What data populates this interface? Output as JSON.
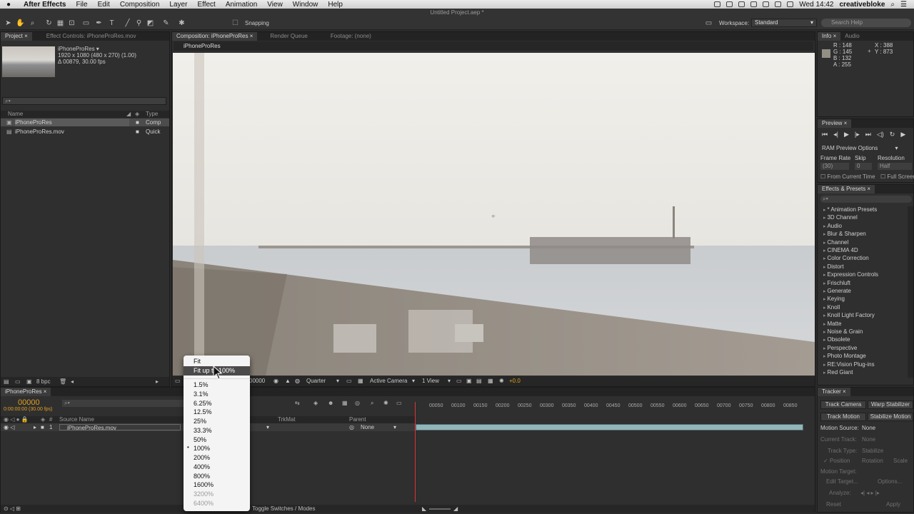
{
  "menubar": {
    "app_name": "After Effects",
    "menus": [
      "File",
      "Edit",
      "Composition",
      "Layer",
      "Effect",
      "Animation",
      "View",
      "Window",
      "Help"
    ],
    "clock": "Wed 14:42",
    "user": "creativebloke"
  },
  "toolbar": {
    "document_title": "Untitled Project.aep *",
    "snapping": "Snapping",
    "workspace_label": "Workspace:",
    "workspace_value": "Standard",
    "search_placeholder": "Search Help"
  },
  "project": {
    "tabs": [
      "Project ×",
      "Effect Controls: iPhoneProRes.mov"
    ],
    "item_name": "iPhoneProRes ▾",
    "item_res": "1920 x 1080  (480 x 270) (1.00)",
    "item_dur": "Δ 00879, 30.00 fps",
    "search_placeholder": "⌕▾",
    "col_name": "Name",
    "col_type": "Type",
    "rows": [
      {
        "name": "iPhoneProRes",
        "type": "Comp"
      },
      {
        "name": "iPhoneProRes.mov",
        "type": "Quick"
      }
    ],
    "bpc": "8 bpc"
  },
  "composition": {
    "tabs": [
      "Composition: iPhoneProRes ×",
      "Render Queue",
      "Footage: (none)"
    ],
    "subtab": "iPhoneProRes",
    "footer": {
      "timecode": "00000",
      "resolution": "Quarter",
      "camera": "Active Camera",
      "view": "1 View",
      "exposure": "+0.0"
    }
  },
  "info": {
    "tabs": [
      "Info ×",
      "Audio"
    ],
    "r": "R : 148",
    "g": "G : 145",
    "b": "B : 132",
    "a": "A : 255",
    "x": "X : 388",
    "y": "Y : 873"
  },
  "preview": {
    "tab": "Preview ×",
    "ram_options": "RAM Preview Options",
    "frame_rate_label": "Frame Rate",
    "skip_label": "Skip",
    "resolution_label": "Resolution",
    "frame_rate_value": "(30)",
    "skip_value": "0",
    "resolution_value": "Half",
    "from_current": "From Current Time",
    "full_screen": "Full Screen"
  },
  "effects": {
    "tab": "Effects & Presets ×",
    "search_placeholder": "⌕▾",
    "items": [
      "* Animation Presets",
      "3D Channel",
      "Audio",
      "Blur & Sharpen",
      "Channel",
      "CINEMA 4D",
      "Color Correction",
      "Distort",
      "Expression Controls",
      "Frischluft",
      "Generate",
      "Keying",
      "Knoll",
      "Knoll Light Factory",
      "Matte",
      "Noise & Grain",
      "Obsolete",
      "Perspective",
      "Photo Montage",
      "RE:Vision Plug-ins",
      "Red Giant"
    ]
  },
  "tracker": {
    "tab": "Tracker ×",
    "track_camera": "Track Camera",
    "warp_stabilizer": "Warp Stabilizer",
    "track_motion": "Track Motion",
    "stabilize_motion": "Stabilize Motion",
    "motion_source_label": "Motion Source:",
    "motion_source_value": "None",
    "current_track_label": "Current Track:",
    "current_track_value": "None",
    "track_type_label": "Track Type:",
    "track_type_value": "Stabilize",
    "position": "✓ Position",
    "rotation": "Rotation",
    "scale": "Scale",
    "motion_target": "Motion Target:",
    "edit_target": "Edit Target...",
    "options": "Options...",
    "analyze": "Analyze:",
    "reset": "Reset",
    "apply": "Apply"
  },
  "timeline": {
    "tab": "iPhoneProRes ×",
    "timecode": "00000",
    "timecode_sub": "0:00:00:00 (30.00 fps)",
    "col_source": "Source Name",
    "col_trkmat": "TrkMat",
    "col_parent": "Parent",
    "layer_index": "1",
    "layer_name": "iPhoneProRes.mov",
    "layer_parent": "None",
    "ruler": [
      "00050",
      "00100",
      "00150",
      "00200",
      "00250",
      "00300",
      "00350",
      "00400",
      "00450",
      "00500",
      "00550",
      "00600",
      "00650",
      "00700",
      "00750",
      "00800",
      "00850"
    ],
    "footer": "Toggle Switches / Modes"
  },
  "zoom_menu": {
    "items": [
      {
        "label": "Fit",
        "state": "normal"
      },
      {
        "label": "Fit up to 100%",
        "state": "highlighted"
      },
      {
        "label": "1.5%",
        "state": "normal"
      },
      {
        "label": "3.1%",
        "state": "normal"
      },
      {
        "label": "6.25%",
        "state": "normal"
      },
      {
        "label": "12.5%",
        "state": "normal"
      },
      {
        "label": "25%",
        "state": "normal"
      },
      {
        "label": "33.3%",
        "state": "normal"
      },
      {
        "label": "50%",
        "state": "normal"
      },
      {
        "label": "100%",
        "state": "checked"
      },
      {
        "label": "200%",
        "state": "normal"
      },
      {
        "label": "400%",
        "state": "normal"
      },
      {
        "label": "800%",
        "state": "normal"
      },
      {
        "label": "1600%",
        "state": "normal"
      },
      {
        "label": "3200%",
        "state": "disabled"
      },
      {
        "label": "6400%",
        "state": "disabled"
      }
    ]
  },
  "colors": {
    "panel_bg": "#2f2f2f",
    "timecode": "#e0a020",
    "layer_bar": "#8fb7b7",
    "playhead": "#dd3333"
  }
}
